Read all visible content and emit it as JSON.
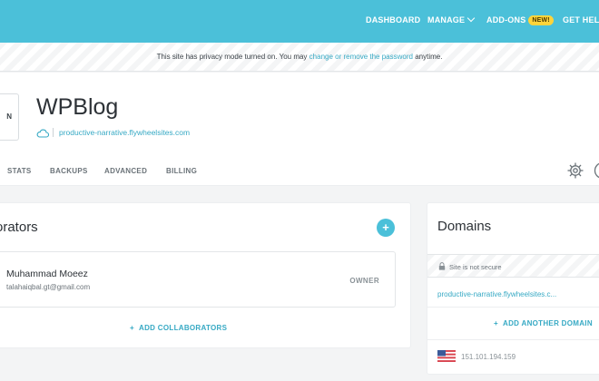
{
  "nav": {
    "items": [
      "DASHBOARD",
      "MANAGE",
      "ADD-ONS",
      "GET HELP"
    ],
    "new_badge": "NEW!",
    "colors": {
      "bar": "#4bc0d9",
      "badge": "#ffd43b"
    }
  },
  "privacy": {
    "prefix": "This site has privacy mode turned on. You may",
    "link": "change or remove the password",
    "suffix": "anytime."
  },
  "site": {
    "thumb_label": "N",
    "title": "WPBlog",
    "domain": "productive-narrative.flywheelsites.com",
    "tabs": [
      "STATS",
      "BACKUPS",
      "ADVANCED",
      "BILLING"
    ]
  },
  "collaborators": {
    "title": "orators",
    "members": [
      {
        "name": "Muhammad Moeez",
        "email": "talahaiqbal.gt@gmail.com",
        "role": "OWNER"
      }
    ],
    "add_label": "ADD COLLABORATORS",
    "add_symbol": "+"
  },
  "domains": {
    "title": "Domains",
    "secure_status": "Site is not secure",
    "primary_domain": "productive-narrative.flywheelsites.c...",
    "add_label": "ADD ANOTHER DOMAIN",
    "add_symbol": "+",
    "ip": "151.101.194.159"
  },
  "icons": [
    "chevron-down-icon",
    "cloud-icon",
    "gear-icon",
    "help-icon",
    "plus-icon",
    "lock-icon",
    "us-flag-icon"
  ]
}
